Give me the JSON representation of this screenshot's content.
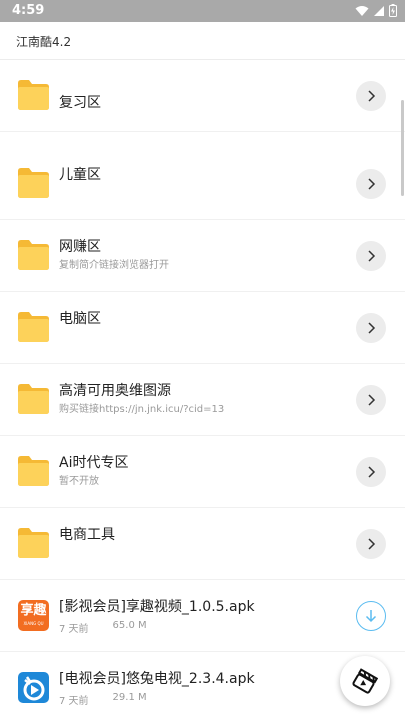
{
  "status_bar": {
    "time": "4:59"
  },
  "header": {
    "title": "江南酷4.2"
  },
  "colors": {
    "folder": "#fdd25a",
    "folder_tab": "#f5b935",
    "accent": "#5bbcf0"
  },
  "folders": [
    {
      "name": "复习区",
      "subtitle": ""
    },
    {
      "name": "儿童区",
      "subtitle": ""
    },
    {
      "name": "网赚区",
      "subtitle": "复制简介链接浏览器打开"
    },
    {
      "name": "电脑区",
      "subtitle": ""
    },
    {
      "name": "高清可用奥维图源",
      "subtitle": "购买链接https://jn.jnk.icu/?cid=13"
    },
    {
      "name": "Ai时代专区",
      "subtitle": "暂不开放"
    },
    {
      "name": "电商工具",
      "subtitle": ""
    }
  ],
  "files": [
    {
      "name": "[影视会员]享趣视频_1.0.5.apk",
      "age": "7 天前",
      "size": "65.0 M",
      "icon_text": "享趣",
      "icon_sub": "XIANG QU",
      "icon_color": "#f26d21"
    },
    {
      "name": "[电视会员]悠兔电视_2.3.4.apk",
      "age": "7 天前",
      "size": "29.1 M",
      "icon_color": "#1e88d8"
    }
  ]
}
